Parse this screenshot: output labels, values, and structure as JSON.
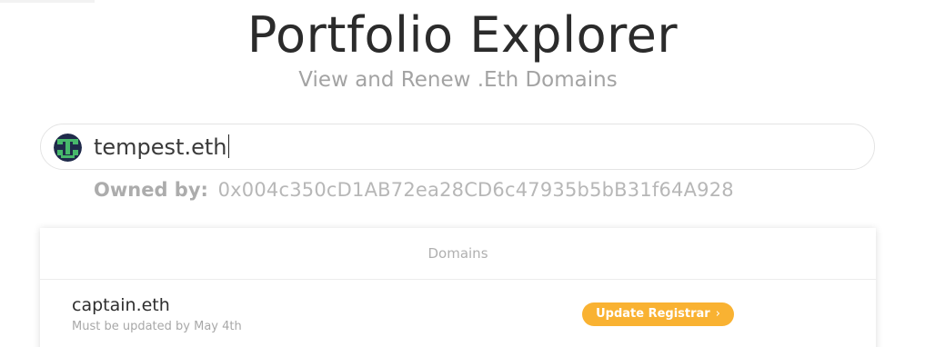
{
  "header": {
    "title": "Portfolio Explorer",
    "subtitle": "View and Renew .Eth Domains"
  },
  "search": {
    "value": "tempest.eth",
    "avatar_icon": "pixel-avatar-icon"
  },
  "owner": {
    "label": "Owned by:",
    "address": "0x004c350cD1AB72ea28CD6c47935b5bB31f64A928"
  },
  "domains": {
    "header": "Domains",
    "items": [
      {
        "name": "captain.eth",
        "note": "Must be updated by May 4th",
        "action_label": "Update Registrar",
        "action_icon": "chevron-right-icon"
      }
    ]
  },
  "colors": {
    "accent": "#f9b232",
    "title": "#2b2b2b",
    "muted": "#a3a3a3"
  }
}
